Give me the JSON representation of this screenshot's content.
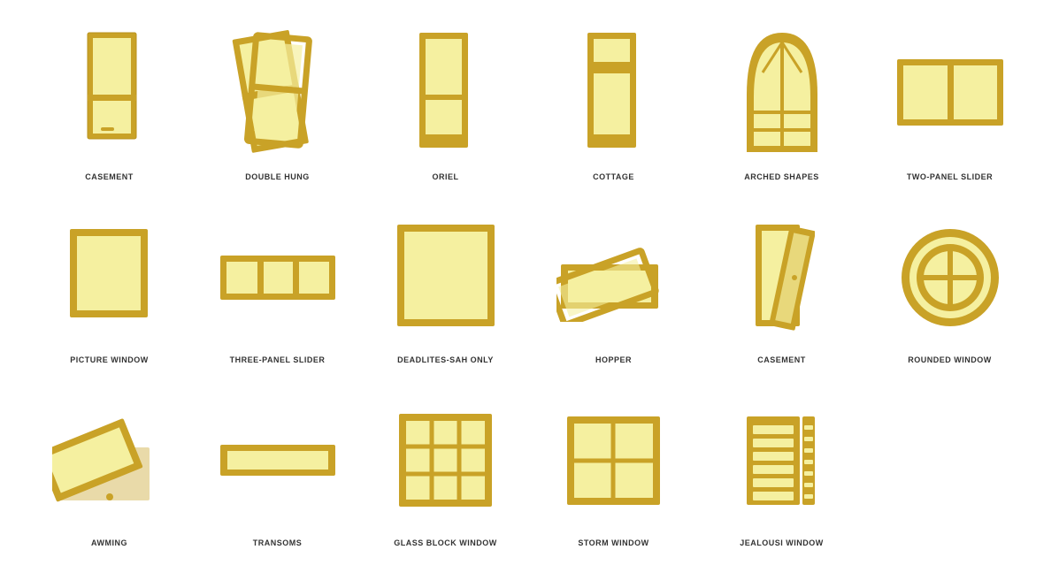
{
  "windows": [
    {
      "id": "casement",
      "label": "CASEMENT"
    },
    {
      "id": "double-hung",
      "label": "DOUBLE HUNG"
    },
    {
      "id": "oriel",
      "label": "ORIEL"
    },
    {
      "id": "cottage",
      "label": "COTTAGE"
    },
    {
      "id": "arched-shapes",
      "label": "ARCHED SHAPES"
    },
    {
      "id": "two-panel-slider",
      "label": "TWO-PANEL SLIDER"
    },
    {
      "id": "picture-window",
      "label": "PICTURE WINDOW"
    },
    {
      "id": "three-panel-slider",
      "label": "THREE-PANEL SLIDER"
    },
    {
      "id": "deadlites-sah-only",
      "label": "DEADLITES-SAH ONLY"
    },
    {
      "id": "hopper",
      "label": "HOPPER"
    },
    {
      "id": "casement2",
      "label": "CASEMENT"
    },
    {
      "id": "rounded-window",
      "label": "ROUNDED WINDOW"
    },
    {
      "id": "awming",
      "label": "AWMING"
    },
    {
      "id": "transoms",
      "label": "TRANSOMS"
    },
    {
      "id": "glass-block-window",
      "label": "GLASS BLOCK WINDOW"
    },
    {
      "id": "storm-window",
      "label": "STORM WINDOW"
    },
    {
      "id": "jealousi-window",
      "label": "JEALOUSI WINDOW"
    }
  ]
}
